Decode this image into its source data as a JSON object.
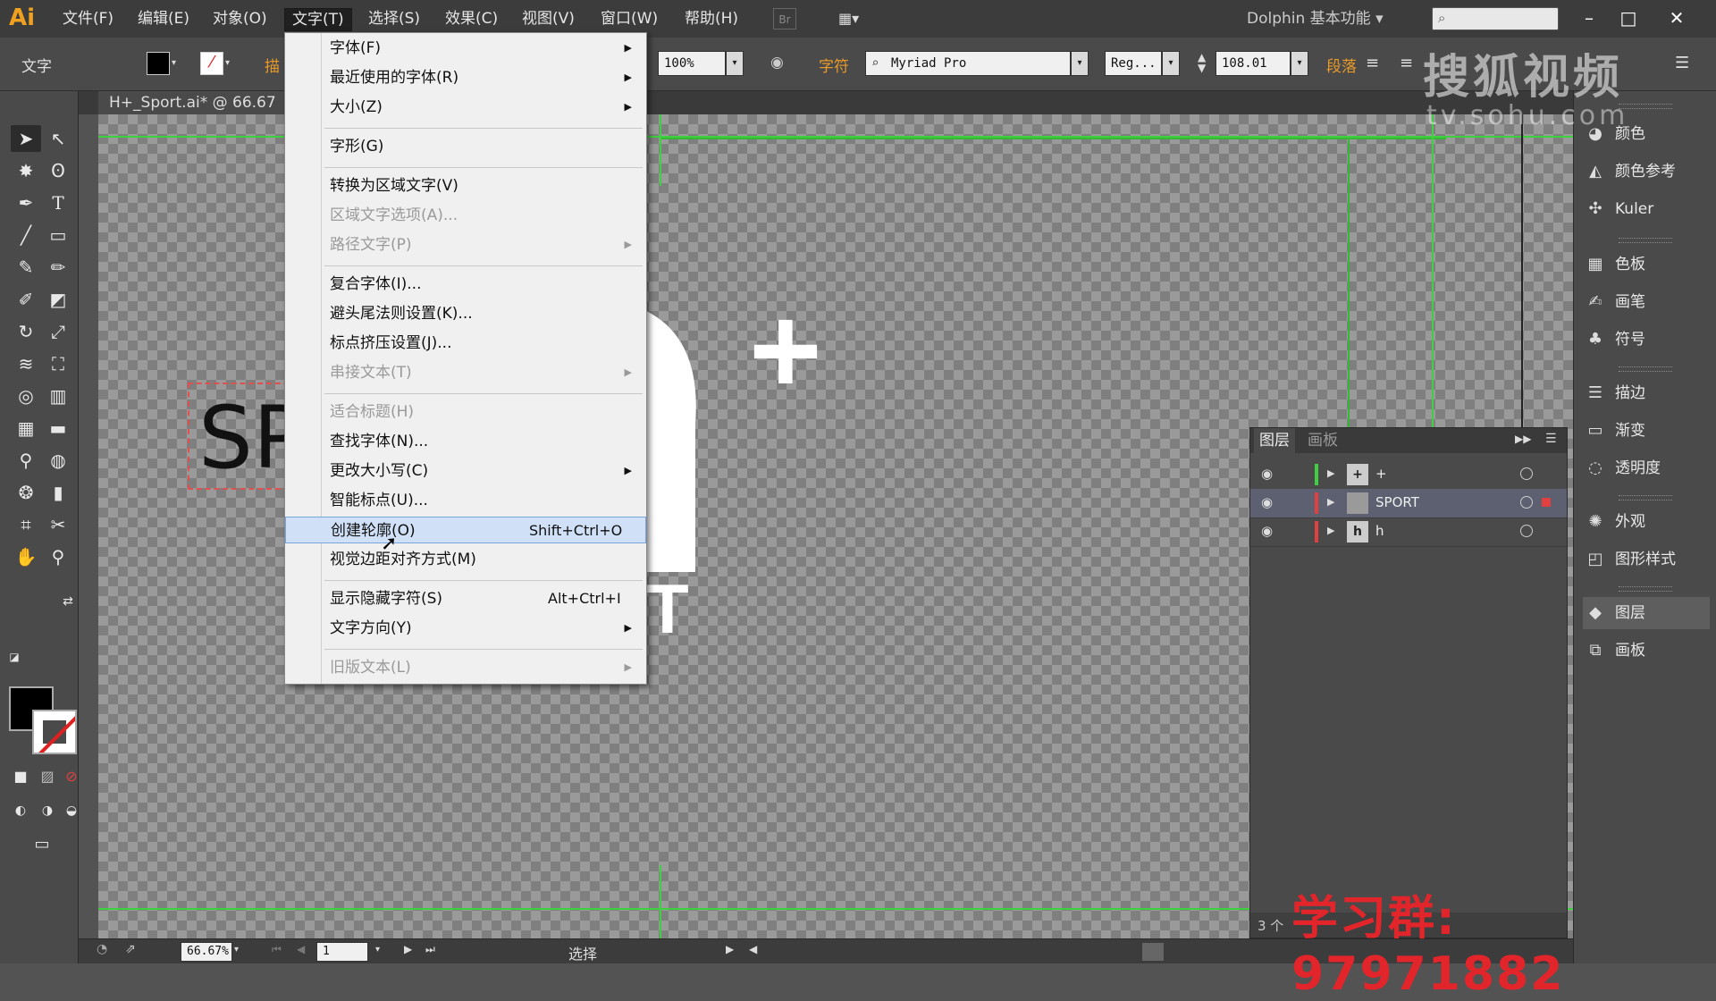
{
  "menubar": {
    "items": [
      "文件(F)",
      "编辑(E)",
      "对象(O)",
      "文字(T)",
      "选择(S)",
      "效果(C)",
      "视图(V)",
      "窗口(W)",
      "帮助(H)"
    ],
    "open_index": 3,
    "workspace": "Dolphin 基本功能"
  },
  "app": {
    "logo": "Ai"
  },
  "controlbar": {
    "tool_label": "文字",
    "stroke_label": "描",
    "opacity": "100%",
    "char_label": "字符",
    "font": "Myriad Pro",
    "style": "Reg...",
    "size": "108.01",
    "para_label": "段落"
  },
  "document": {
    "tab": "H+_Sport.ai* @ 66.67"
  },
  "type_menu": {
    "items": [
      {
        "label": "字体(F)",
        "arrow": true,
        "disabled": false
      },
      {
        "label": "最近使用的字体(R)",
        "arrow": true,
        "disabled": false
      },
      {
        "label": "大小(Z)",
        "arrow": true,
        "disabled": false
      },
      {
        "label": "字形(G)",
        "arrow": false,
        "disabled": false
      },
      {
        "label": "转换为区域文字(V)",
        "arrow": false,
        "disabled": false
      },
      {
        "label": "区域文字选项(A)...",
        "arrow": false,
        "disabled": true
      },
      {
        "label": "路径文字(P)",
        "arrow": true,
        "disabled": true
      },
      {
        "label": "复合字体(I)...",
        "arrow": false,
        "disabled": false
      },
      {
        "label": "避头尾法则设置(K)...",
        "arrow": false,
        "disabled": false
      },
      {
        "label": "标点挤压设置(J)...",
        "arrow": false,
        "disabled": false
      },
      {
        "label": "串接文本(T)",
        "arrow": true,
        "disabled": true
      },
      {
        "label": "适合标题(H)",
        "arrow": false,
        "disabled": true
      },
      {
        "label": "查找字体(N)...",
        "arrow": false,
        "disabled": false
      },
      {
        "label": "更改大小写(C)",
        "arrow": true,
        "disabled": false
      },
      {
        "label": "智能标点(U)...",
        "arrow": false,
        "disabled": false
      },
      {
        "label": "创建轮廓(O)",
        "shortcut": "Shift+Ctrl+O",
        "arrow": false,
        "disabled": false,
        "highlighted": true
      },
      {
        "label": "视觉边距对齐方式(M)",
        "arrow": false,
        "disabled": false
      },
      {
        "label": "显示隐藏字符(S)",
        "shortcut": "Alt+Ctrl+I",
        "arrow": false,
        "disabled": false
      },
      {
        "label": "文字方向(Y)",
        "arrow": true,
        "disabled": false
      },
      {
        "label": "旧版文本(L)",
        "arrow": true,
        "disabled": true
      }
    ]
  },
  "artboard": {
    "text_object": "SP",
    "plus_glyph": "+",
    "sport_word": "SPORT"
  },
  "dock": {
    "items": [
      "颜色",
      "颜色参考",
      "Kuler",
      "色板",
      "画笔",
      "符号",
      "描边",
      "渐变",
      "透明度",
      "外观",
      "图形样式",
      "图层",
      "画板"
    ],
    "icons": [
      "palette-icon",
      "color-guide-icon",
      "kuler-icon",
      "swatches-icon",
      "brushes-icon",
      "symbols-icon",
      "stroke-icon",
      "gradient-icon",
      "transparency-icon",
      "appearance-icon",
      "graphic-styles-icon",
      "layers-icon",
      "artboards-icon"
    ],
    "active_index": 11
  },
  "layers_panel": {
    "tabs": [
      "图层",
      "画板"
    ],
    "rows": [
      {
        "name": "+",
        "color": "#3fd03f",
        "selected": false
      },
      {
        "name": "SPORT",
        "color": "#e04040",
        "selected": true
      },
      {
        "name": "h",
        "color": "#e04040",
        "selected": false
      }
    ],
    "count": "3 个"
  },
  "statusbar": {
    "zoom": "66.67%",
    "page": "1",
    "mode": "选择"
  },
  "watermarks": {
    "logo": "搜狐视频",
    "url": "tv.sohu.com",
    "group": "学习群: 97971882"
  },
  "colors": {
    "guide": "#3fd03f",
    "accent": "#e89a2a",
    "highlight": "#cfe0f7"
  }
}
